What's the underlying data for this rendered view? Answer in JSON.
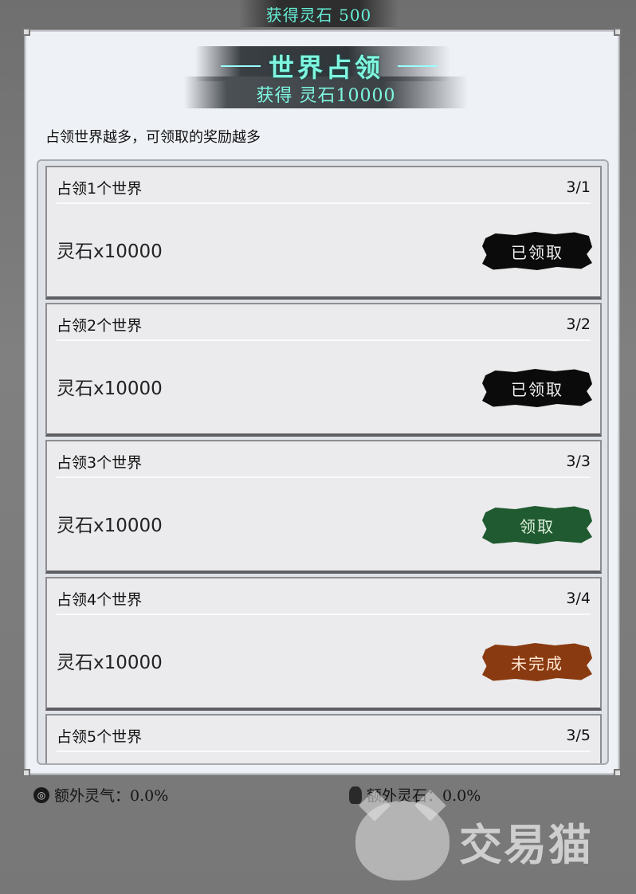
{
  "top_banner": {
    "text": "获得灵石 500"
  },
  "panel": {
    "title": "世界占领",
    "subtitle": "获得 灵石10000",
    "description": "占领世界越多，可领取的奖励越多"
  },
  "rewards": [
    {
      "name": "占领1个世界",
      "progress": "3/1",
      "reward": "灵石x10000",
      "button": "已领取",
      "state": "claimed"
    },
    {
      "name": "占领2个世界",
      "progress": "3/2",
      "reward": "灵石x10000",
      "button": "已领取",
      "state": "claimed"
    },
    {
      "name": "占领3个世界",
      "progress": "3/3",
      "reward": "灵石x10000",
      "button": "领取",
      "state": "claim"
    },
    {
      "name": "占领4个世界",
      "progress": "3/4",
      "reward": "灵石x10000",
      "button": "未完成",
      "state": "undone"
    },
    {
      "name": "占领5个世界",
      "progress": "3/5",
      "reward": "",
      "button": "",
      "state": ""
    }
  ],
  "footer": {
    "extra_qi": "额外灵气：0.0%",
    "extra_stone": "额外灵石：0.0%"
  },
  "watermark": {
    "text": "交易猫"
  },
  "colors": {
    "title_cyan": "#7ef7e0",
    "claimed_button": "#0b0b0b",
    "claim_button": "#1f5a30",
    "undone_button": "#8a3a10"
  }
}
